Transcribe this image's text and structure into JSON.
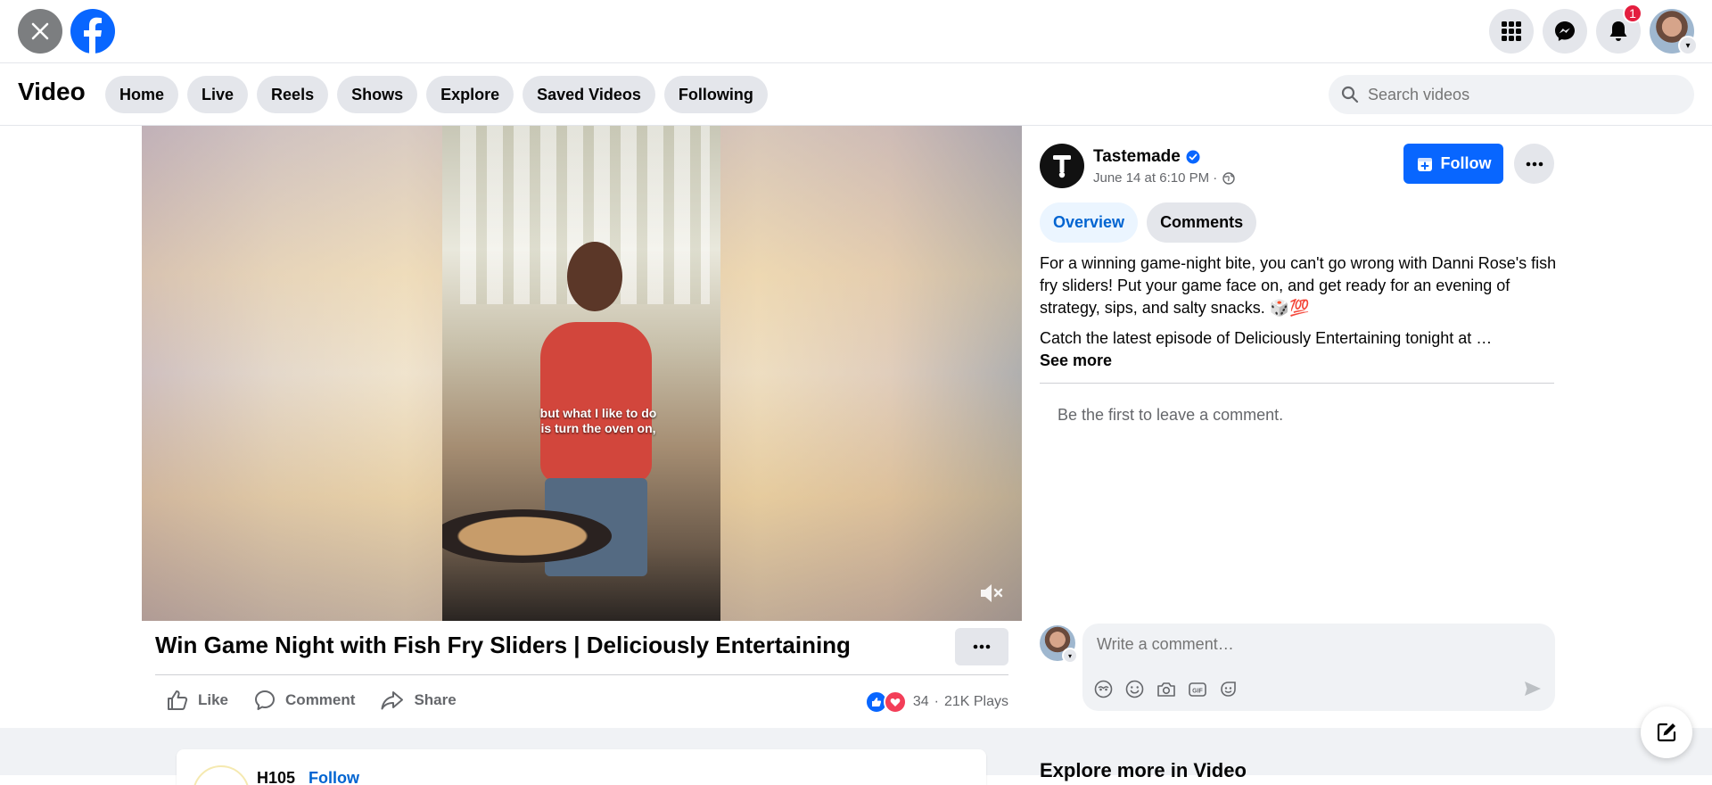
{
  "header": {
    "notifications_count": "1"
  },
  "nav": {
    "title": "Video",
    "tabs": [
      {
        "label": "Home"
      },
      {
        "label": "Live"
      },
      {
        "label": "Reels"
      },
      {
        "label": "Shows"
      },
      {
        "label": "Explore"
      },
      {
        "label": "Saved Videos"
      },
      {
        "label": "Following"
      }
    ],
    "search_placeholder": "Search videos"
  },
  "video": {
    "caption_line1": "but what I like to do",
    "caption_line2": "is turn the oven on,",
    "title": "Win Game Night with Fish Fry Sliders | Deliciously Entertaining",
    "actions": {
      "like": "Like",
      "comment": "Comment",
      "share": "Share"
    },
    "reaction_count": "34",
    "separator": "·",
    "plays": "21K Plays"
  },
  "post": {
    "page_name": "Tastemade",
    "timestamp": "June 14 at 6:10 PM ·",
    "follow_label": "Follow",
    "tabs": {
      "overview": "Overview",
      "comments": "Comments"
    },
    "description_1": "For a winning game-night bite, you can't go wrong with Danni Rose's fish fry sliders! Put your game face on, and get ready for an evening of strategy, sips, and salty snacks. 🎲💯",
    "description_2": "Catch the latest episode of Deliciously Entertaining tonight at …",
    "see_more": "See more",
    "empty_comments": "Be the first to leave a comment.",
    "comment_placeholder": "Write a comment…"
  },
  "feed": {
    "next_card_name": "H105",
    "next_card_follow": "Follow",
    "explore_more": "Explore more in Video"
  },
  "colors": {
    "brand_blue": "#0866ff",
    "badge_red": "#e41e3f",
    "tab_grey": "#e4e6eb"
  }
}
